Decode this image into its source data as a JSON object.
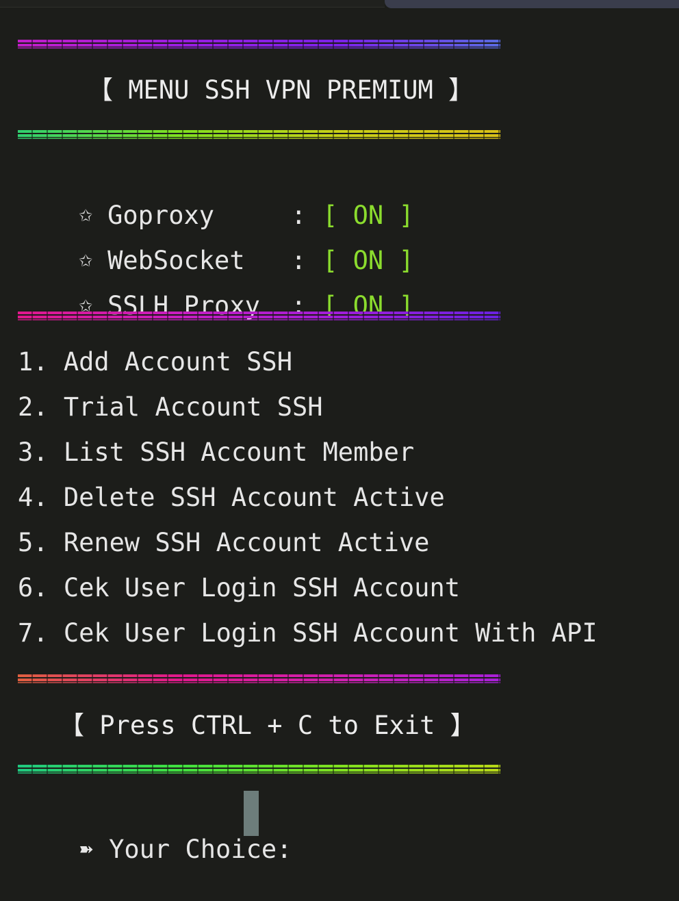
{
  "terminal": {
    "title": "【 MENU SSH VPN PREMIUM 】",
    "status": [
      {
        "icon": "star-outline-icon",
        "star": "✩",
        "name": "Goproxy",
        "colon": ":",
        "state": "[ ON ]"
      },
      {
        "icon": "star-outline-icon",
        "star": "✩",
        "name": "WebSocket",
        "colon": ":",
        "state": "[ ON ]"
      },
      {
        "icon": "star-outline-icon",
        "star": "✩",
        "name": "SSLH Proxy",
        "colon": ":",
        "state": "[ ON ]"
      }
    ],
    "menu": [
      "1. Add Account SSH",
      "2. Trial Account SSH",
      "3. List SSH Account Member",
      "4. Delete SSH Account Active",
      "5. Renew SSH Account Active",
      "6. Cek User Login SSH Account",
      "7. Cek User Login SSH Account With API"
    ],
    "exit_hint": "【 Press CTRL + C to Exit 】",
    "prompt_arrow": "➽",
    "prompt_label": "Your Choice:",
    "prompt_value": ""
  },
  "colors": {
    "background": "#1c1d1a",
    "text": "#e6e6e6",
    "status_on": "#8bdc2e",
    "cursor": "#6d7d7b",
    "rule_1": [
      "#c21ec8",
      "#9a1ee0",
      "#7b22e8",
      "#5a6be0"
    ],
    "rule_2": [
      "#30d070",
      "#80e020",
      "#c8d018",
      "#d8c018"
    ],
    "rule_3": [
      "#e0188c",
      "#c81ec0",
      "#a01ed8",
      "#6a22e0"
    ],
    "rule_4": [
      "#e06040",
      "#e0188c",
      "#d020b0",
      "#a820d8"
    ],
    "rule_5": [
      "#20c880",
      "#40e040",
      "#80e020",
      "#b8d818"
    ]
  }
}
